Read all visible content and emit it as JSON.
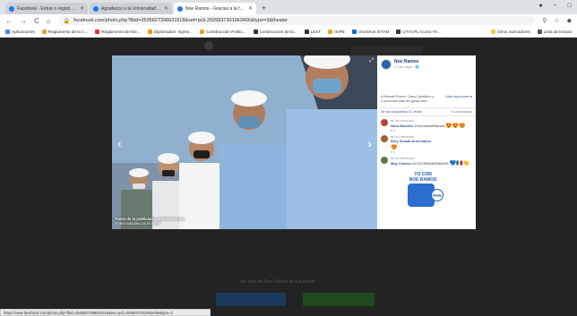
{
  "tabs": [
    {
      "title": "Facebook - Entrar o registrarse",
      "active": false
    },
    {
      "title": "Agradezco a la Universidad ... - V",
      "active": false
    },
    {
      "title": "Noe Ramos - Gracias a la familia",
      "active": true
    }
  ],
  "toolbar": {
    "url": "facebook.com/photo.php?fbid=2505827398631518&set=pcb.2505837301963406&type=3&theater"
  },
  "bookmarks": {
    "items": [
      "Aplicaciones",
      "Reglamento de la C...",
      "Reglamento-de-Ele...",
      "Diplomados: Ingres...",
      "Construcción Polític...",
      "Construcción de fa...",
      "LEST",
      "ISIPE",
      "OneDrive ISTAM",
      "UTVCPL-Curso-TA..."
    ],
    "right": [
      "Otros marcadores",
      "Lista de lectura"
    ]
  },
  "photo": {
    "caption_line1": "Fotos de la publicación de Noe Ramos",
    "caption_line2": "Fotos subidas con el móvil"
  },
  "panel": {
    "author": "Noe Ramos",
    "time": "17 de mayo · 🌐",
    "reactions_text": "A Manuel Flores, Clara Caballero y 2 personas más les gusta esto.",
    "more_reactions": "Más reacciones ▾",
    "share_link": "Se ha compartido 11 veces",
    "comments_count": "0 comentarios",
    "comments": [
      {
        "tag": "Fan destacado",
        "name": "Nora Morales",
        "text": "#YoconNoeRamos",
        "emoji": "😍😍😍",
        "time": "9 d",
        "avatar_color": "#b5473a"
      },
      {
        "tag": "Fan destacado",
        "name": "Bety Zavala Armendáriz",
        "text": "",
        "emoji": "😍",
        "time": "9 d",
        "avatar_color": "#a0622e"
      },
      {
        "tag": "Fan destacado",
        "name": "May Chávez",
        "text": "#YOCONNOERAMOS",
        "emoji": "💙🇲🇽👏",
        "time": "9 d",
        "avatar_color": "#5a7a4a"
      }
    ],
    "card_line1": "YO CON",
    "card_line2": "NOE RAMOS",
    "card_logo": "PAN"
  },
  "page": {
    "bottom_text": "Ver más de Noe Ramos en Facebook"
  },
  "status": {
    "url": "https://www.facebook.com/photo.php?fbid=2505827398631518&set=pcb.2505837301963406&type=3"
  }
}
